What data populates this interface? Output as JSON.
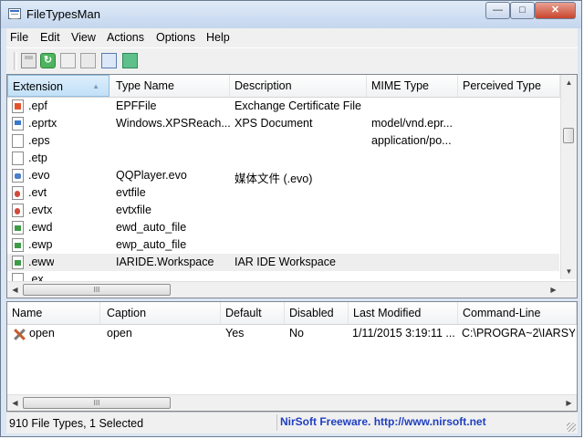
{
  "window": {
    "title": "FileTypesMan"
  },
  "menu": [
    "File",
    "Edit",
    "View",
    "Actions",
    "Options",
    "Help"
  ],
  "types_table": {
    "columns": [
      "Extension",
      "Type Name",
      "Description",
      "MIME Type",
      "Perceived Type"
    ],
    "sorted_column": "Extension",
    "rows": [
      {
        "icon": "document-red-icon",
        "ext": ".epf",
        "type": "EPFFile",
        "desc": "Exchange Certificate File",
        "mime": "",
        "perceived": ""
      },
      {
        "icon": "xps-document-icon",
        "ext": ".eprtx",
        "type": "Windows.XPSReach...",
        "desc": "XPS Document",
        "mime": "model/vnd.epr...",
        "perceived": ""
      },
      {
        "icon": "blank-file-icon",
        "ext": ".eps",
        "type": "",
        "desc": "",
        "mime": "application/po...",
        "perceived": ""
      },
      {
        "icon": "blank-file-icon",
        "ext": ".etp",
        "type": "",
        "desc": "",
        "mime": "",
        "perceived": ""
      },
      {
        "icon": "media-file-icon",
        "ext": ".evo",
        "type": "QQPlayer.evo",
        "desc": "媒体文件 (.evo)",
        "mime": "",
        "perceived": ""
      },
      {
        "icon": "event-log-icon",
        "ext": ".evt",
        "type": "evtfile",
        "desc": "",
        "mime": "",
        "perceived": ""
      },
      {
        "icon": "event-log-icon",
        "ext": ".evtx",
        "type": "evtxfile",
        "desc": "",
        "mime": "",
        "perceived": ""
      },
      {
        "icon": "workspace-file-icon",
        "ext": ".ewd",
        "type": "ewd_auto_file",
        "desc": "",
        "mime": "",
        "perceived": ""
      },
      {
        "icon": "workspace-file-icon",
        "ext": ".ewp",
        "type": "ewp_auto_file",
        "desc": "",
        "mime": "",
        "perceived": ""
      },
      {
        "icon": "workspace-file-icon",
        "ext": ".eww",
        "type": "IARIDE.Workspace",
        "desc": "IAR IDE Workspace",
        "mime": "",
        "perceived": ""
      },
      {
        "icon": "blank-file-icon",
        "ext": ".ex",
        "type": "",
        "desc": "",
        "mime": "",
        "perceived": ""
      }
    ]
  },
  "actions_table": {
    "columns": [
      "Name",
      "Caption",
      "Default",
      "Disabled",
      "Last Modified",
      "Command-Line"
    ],
    "rows": [
      {
        "name": "open",
        "caption": "open",
        "default": "Yes",
        "disabled": "No",
        "modified": "1/11/2015 3:19:11 ...",
        "command": "C:\\PROGRA~2\\IARSYS~"
      }
    ]
  },
  "status": {
    "count_text": "910 File Types, 1 Selected",
    "link_text": "NirSoft Freeware.  http://www.nirsoft.net"
  },
  "scroll_glyphs": {
    "up": "▲",
    "down": "▼",
    "left": "◀",
    "right": "▶",
    "grip": "III"
  },
  "title_buttons": {
    "minimize": "—",
    "maximize": "□",
    "close": "✕"
  },
  "colors": {
    "selection": "#eeeeee",
    "link": "#1f3fbf",
    "frame": "#dbe6f4"
  }
}
